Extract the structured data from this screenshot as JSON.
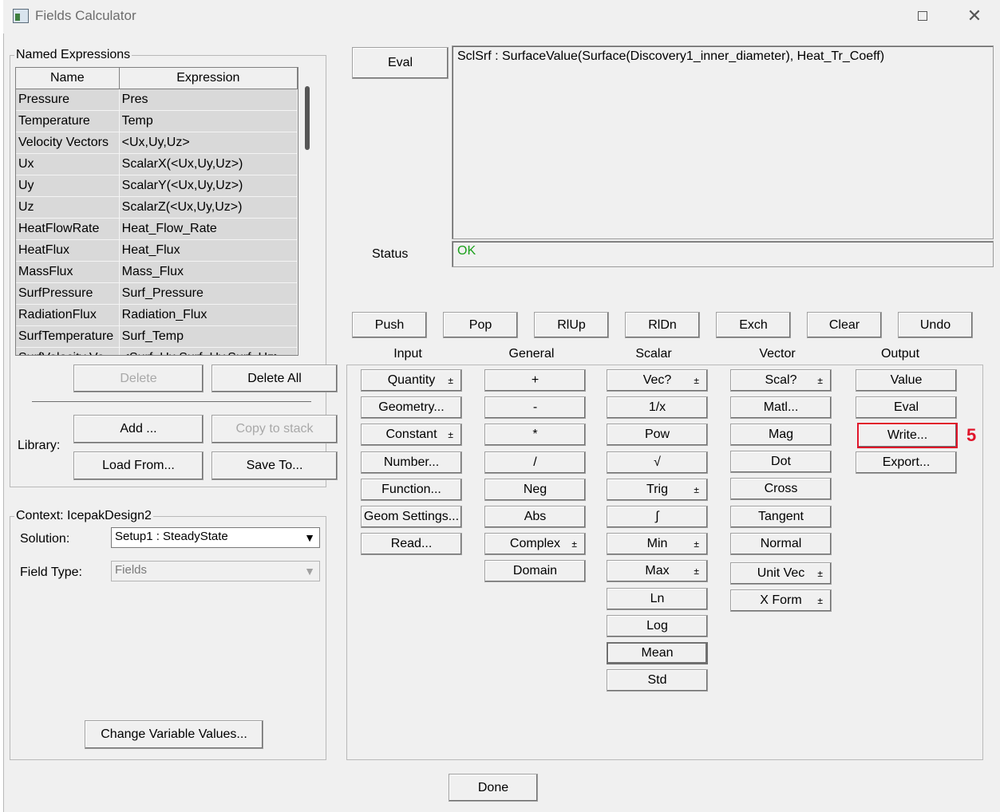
{
  "window": {
    "title": "Fields Calculator"
  },
  "named_expressions": {
    "label": "Named Expressions",
    "columns": [
      "Name",
      "Expression"
    ],
    "rows": [
      {
        "name": "Pressure",
        "expr": "Pres"
      },
      {
        "name": "Temperature",
        "expr": "Temp"
      },
      {
        "name": "Velocity Vectors",
        "expr": "<Ux,Uy,Uz>"
      },
      {
        "name": "Ux",
        "expr": "ScalarX(<Ux,Uy,Uz>)"
      },
      {
        "name": "Uy",
        "expr": "ScalarY(<Ux,Uy,Uz>)"
      },
      {
        "name": "Uz",
        "expr": "ScalarZ(<Ux,Uy,Uz>)"
      },
      {
        "name": "HeatFlowRate",
        "expr": "Heat_Flow_Rate"
      },
      {
        "name": "HeatFlux",
        "expr": "Heat_Flux"
      },
      {
        "name": "MassFlux",
        "expr": "Mass_Flux"
      },
      {
        "name": "SurfPressure",
        "expr": "Surf_Pressure"
      },
      {
        "name": "RadiationFlux",
        "expr": "Radiation_Flux"
      },
      {
        "name": "SurfTemperature",
        "expr": "Surf_Temp"
      },
      {
        "name": "SurfVelocity Ve...",
        "expr": "<Surf_Ux,Surf_Uy,Surf_Uz>"
      }
    ],
    "delete": "Delete",
    "delete_all": "Delete All",
    "library_label": "Library:",
    "add": "Add ...",
    "copy_to_stack": "Copy to stack",
    "load_from": "Load From...",
    "save_to": "Save To..."
  },
  "context": {
    "label": "Context: IcepakDesign2",
    "solution_label": "Solution:",
    "solution_value": "Setup1 : SteadyState",
    "field_type_label": "Field Type:",
    "field_type_value": "Fields",
    "change_vars": "Change Variable Values..."
  },
  "eval_button": "Eval",
  "expression_text": "SclSrf : SurfaceValue(Surface(Discovery1_inner_diameter), Heat_Tr_Coeff)",
  "status_label": "Status",
  "status_value": "OK",
  "stack_buttons": [
    "Push",
    "Pop",
    "RlUp",
    "RlDn",
    "Exch",
    "Clear",
    "Undo"
  ],
  "headers": {
    "input": "Input",
    "general": "General",
    "scalar": "Scalar",
    "vector": "Vector",
    "output": "Output"
  },
  "input_buttons": [
    "Quantity",
    "Geometry...",
    "Constant",
    "Number...",
    "Function...",
    "Geom Settings...",
    "Read..."
  ],
  "general_buttons": [
    "+",
    "-",
    "*",
    "/",
    "Neg",
    "Abs",
    "Complex",
    "Domain"
  ],
  "scalar_buttons": [
    "Vec?",
    "1/x",
    "Pow",
    "√",
    "Trig",
    "∫",
    "Min",
    "Max",
    "Ln",
    "Log",
    "Mean",
    "Std"
  ],
  "vector_buttons": [
    "Scal?",
    "Matl...",
    "Mag",
    "Dot",
    "Cross",
    "Tangent",
    "Normal",
    "Unit Vec",
    "X Form"
  ],
  "output_buttons": [
    "Value",
    "Eval",
    "Write...",
    "Export..."
  ],
  "step_marker": "5",
  "done": "Done",
  "colors": {
    "status_ok": "#1aa01a",
    "highlight": "#e0142a",
    "window_bg": "#f0f0f0"
  },
  "icons": {
    "minimize": "minimize-icon",
    "maximize": "maximize-icon",
    "close": "close-icon",
    "dropdown": "chevron-down-icon",
    "spin": "spin-arrows-icon"
  }
}
